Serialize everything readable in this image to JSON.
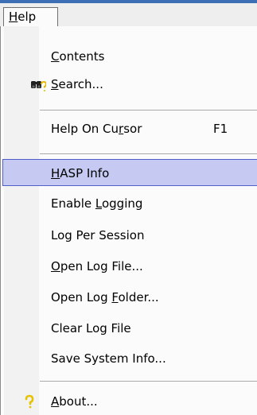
{
  "menubar": {
    "help": {
      "pre": "",
      "acc": "H",
      "post": "elp"
    }
  },
  "menu": {
    "contents": {
      "pre": "",
      "acc": "C",
      "post": "ontents"
    },
    "search": {
      "pre": "",
      "acc": "S",
      "post": "earch..."
    },
    "help_on_cursor": {
      "pre": "Help On Cu",
      "acc": "r",
      "post": "sor",
      "shortcut": "F1"
    },
    "hasp_info": {
      "pre": "",
      "acc": "H",
      "post": "ASP Info"
    },
    "enable_logging": {
      "pre": "Enable ",
      "acc": "L",
      "post": "ogging"
    },
    "log_per_session": {
      "pre": "Log Per Session",
      "acc": "",
      "post": ""
    },
    "open_log_file": {
      "pre": "",
      "acc": "O",
      "post": "pen Log File..."
    },
    "open_log_folder": {
      "pre": "Open Log ",
      "acc": "F",
      "post": "older..."
    },
    "clear_log_file": {
      "pre": "Clear Log File",
      "acc": "",
      "post": ""
    },
    "save_system_info": {
      "pre": "Save System Info...",
      "acc": "",
      "post": ""
    },
    "about": {
      "pre": "",
      "acc": "A",
      "post": "bout..."
    }
  },
  "icons": {
    "search": "binoculars-question-icon",
    "about": "question-mark-icon"
  },
  "colors": {
    "highlight_bg": "#c6c9f1",
    "highlight_border": "#4f5ecb",
    "menubar_accent": "#3d6fb7"
  }
}
